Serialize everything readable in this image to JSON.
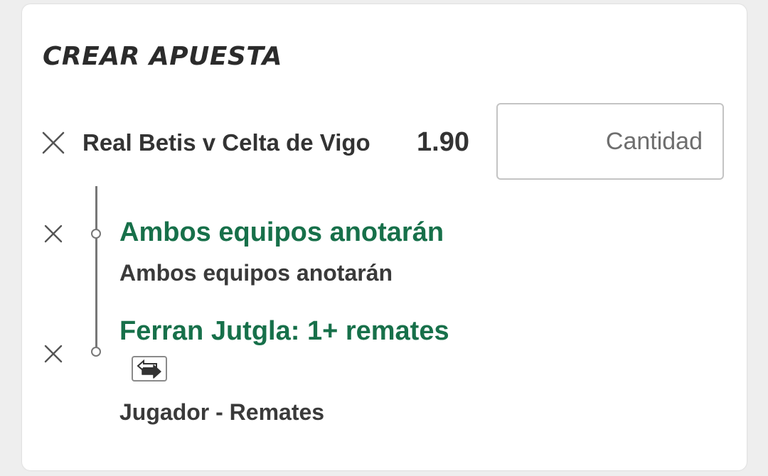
{
  "header": {
    "title": "CREAR APUESTA"
  },
  "event": {
    "name": "Real Betis v Celta de Vigo",
    "odds": "1.90",
    "stake_placeholder": "Cantidad",
    "stake_value": ""
  },
  "selections": [
    {
      "title": "Ambos equipos anotarán",
      "market": "Ambos equipos anotarán"
    },
    {
      "title": "Ferran Jutgla: 1+ remates",
      "market": "Jugador - Remates",
      "badge_icon": "swap-icon"
    }
  ],
  "icons": {
    "remove": "close-icon",
    "node": "circle-node-icon"
  },
  "colors": {
    "accent_green": "#17704a",
    "text_dark": "#333333",
    "background": "#eeeeee",
    "card": "#ffffff"
  }
}
